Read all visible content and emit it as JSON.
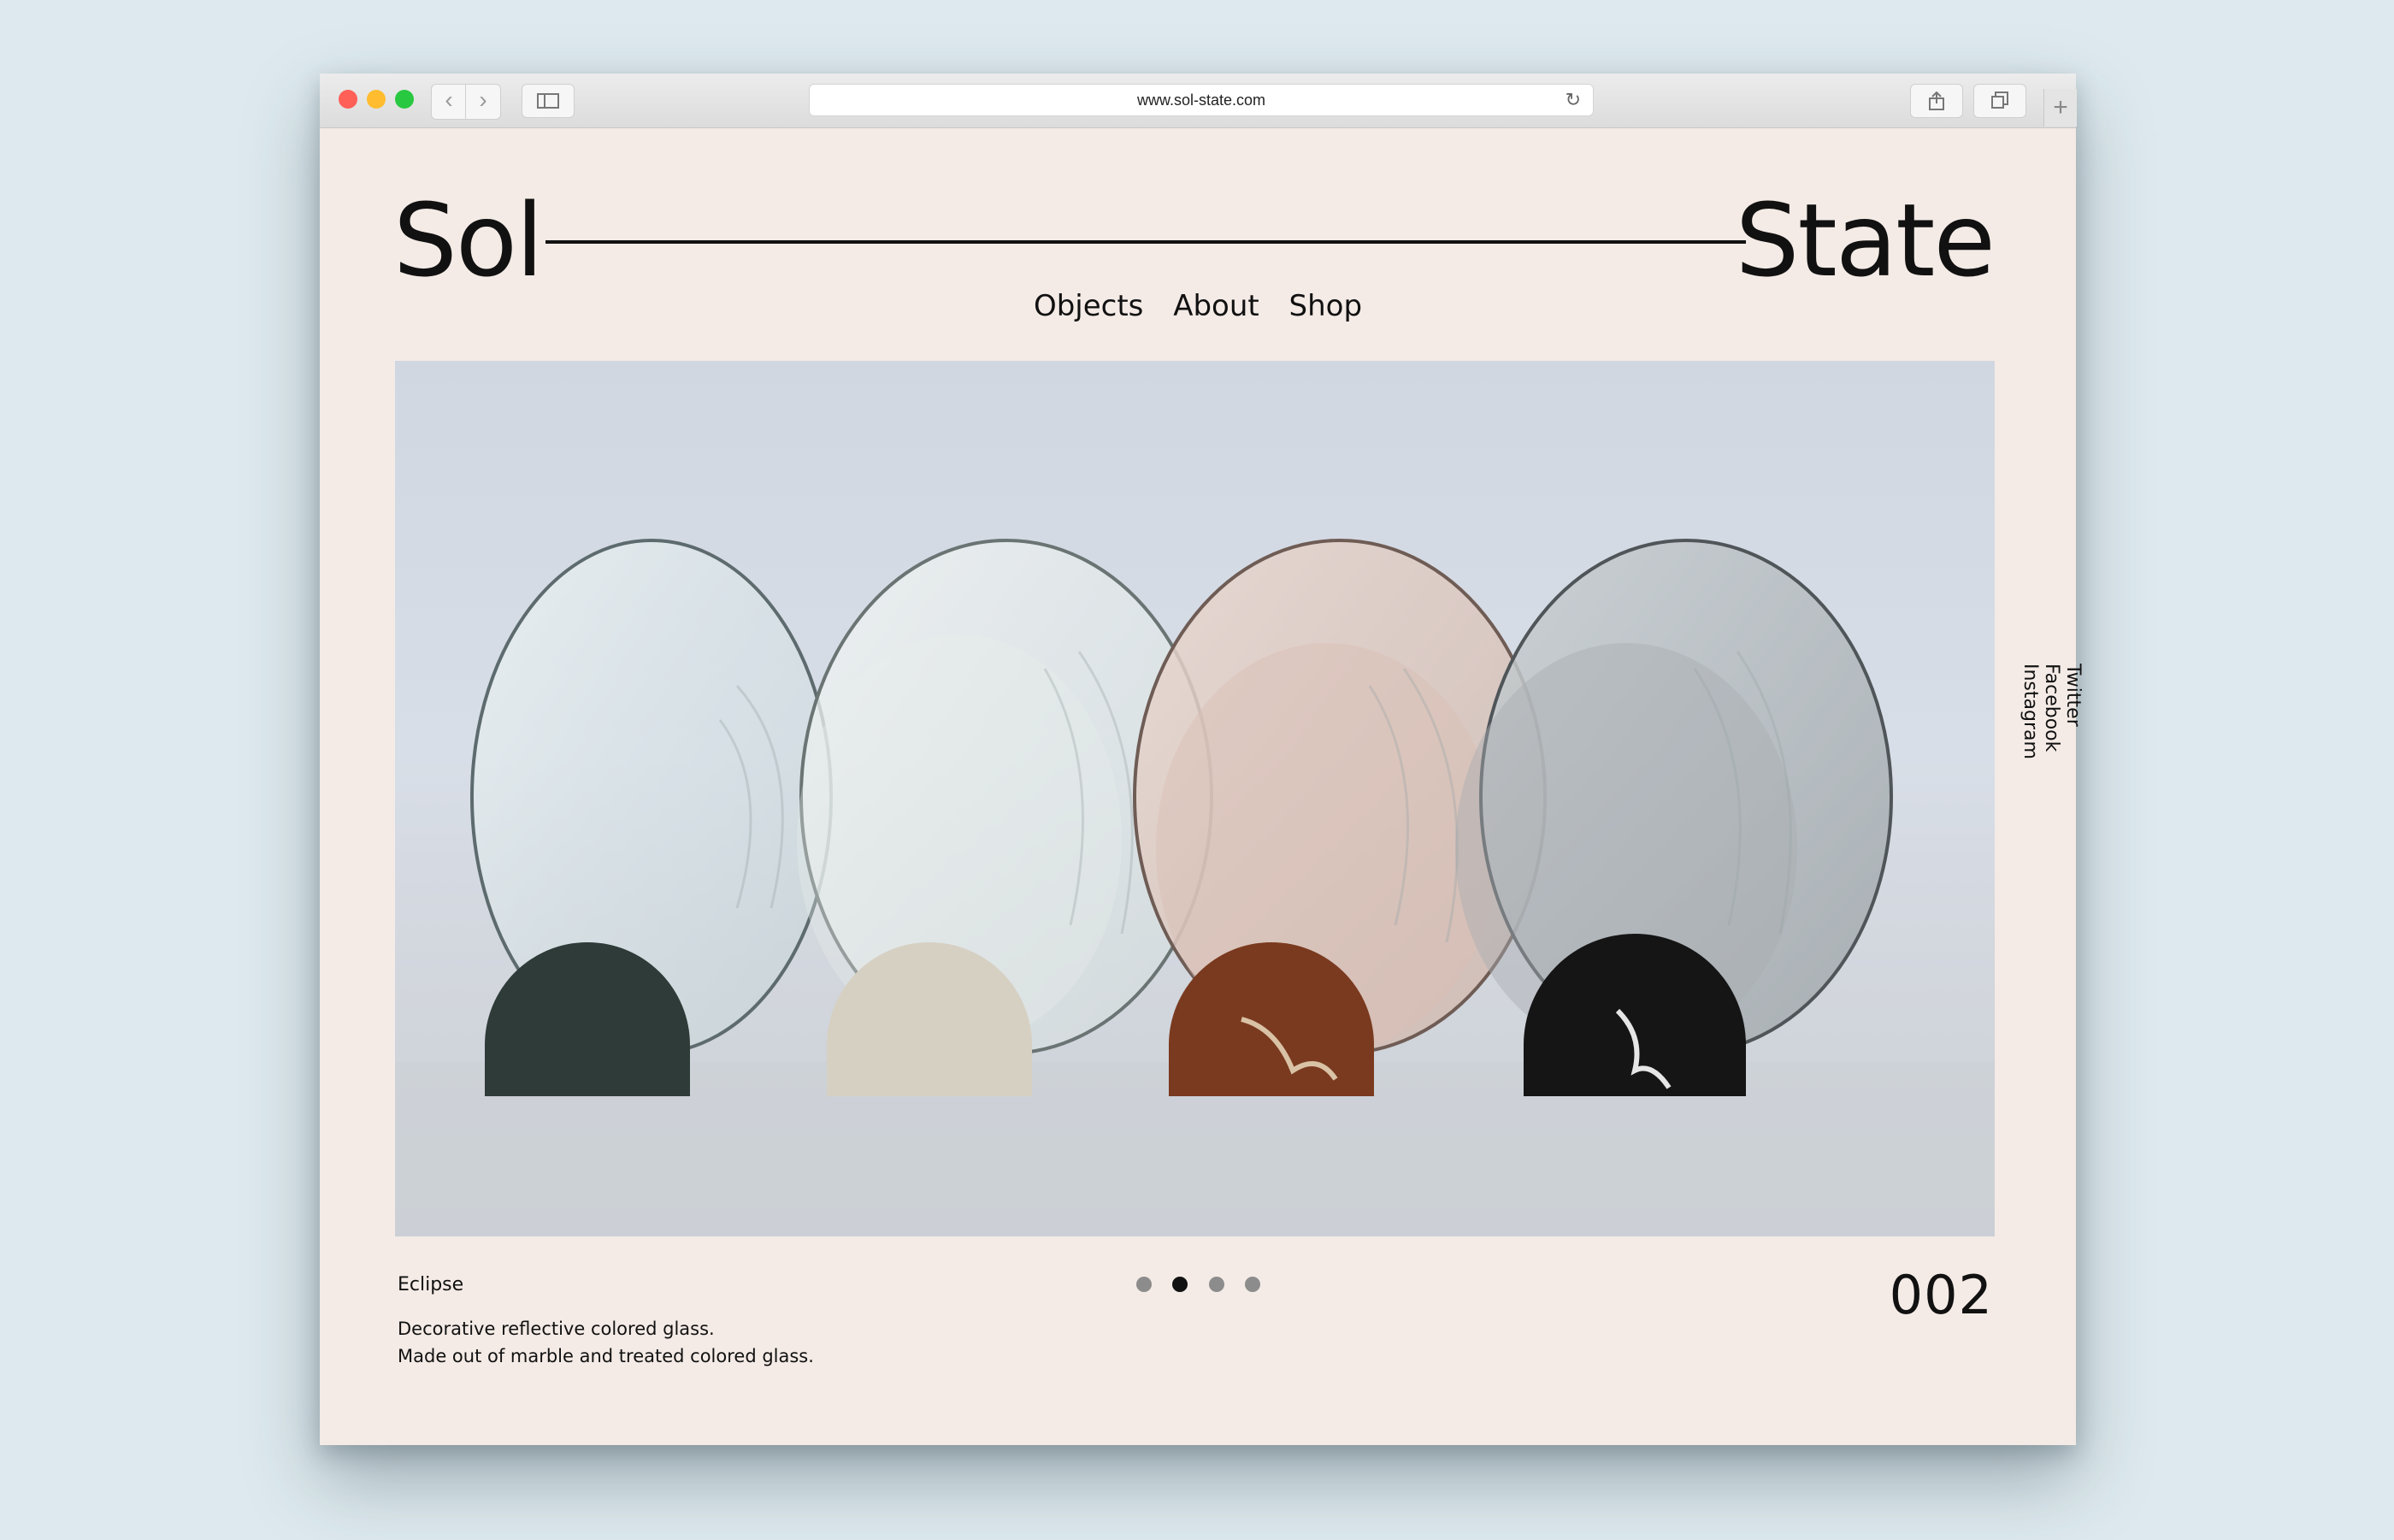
{
  "browser": {
    "url": "www.sol-state.com",
    "back_icon": "‹",
    "forward_icon": "›",
    "reload_icon": "↻",
    "new_tab_icon": "+"
  },
  "brand": {
    "left": "Sol",
    "right": "State"
  },
  "nav": {
    "items": [
      "Objects",
      "About",
      "Shop"
    ]
  },
  "social": [
    "Twitter",
    "Facebook",
    "Instagram"
  ],
  "product": {
    "name": "Eclipse",
    "description_lines": [
      "Decorative reflective colored glass.",
      "Made out of marble and treated colored glass."
    ],
    "counter": "002"
  },
  "slider": {
    "total": 4,
    "active_index": 1
  },
  "colors": {
    "page_bg": "#dde9ee",
    "site_bg": "#f4ebe6",
    "text": "#111111"
  }
}
